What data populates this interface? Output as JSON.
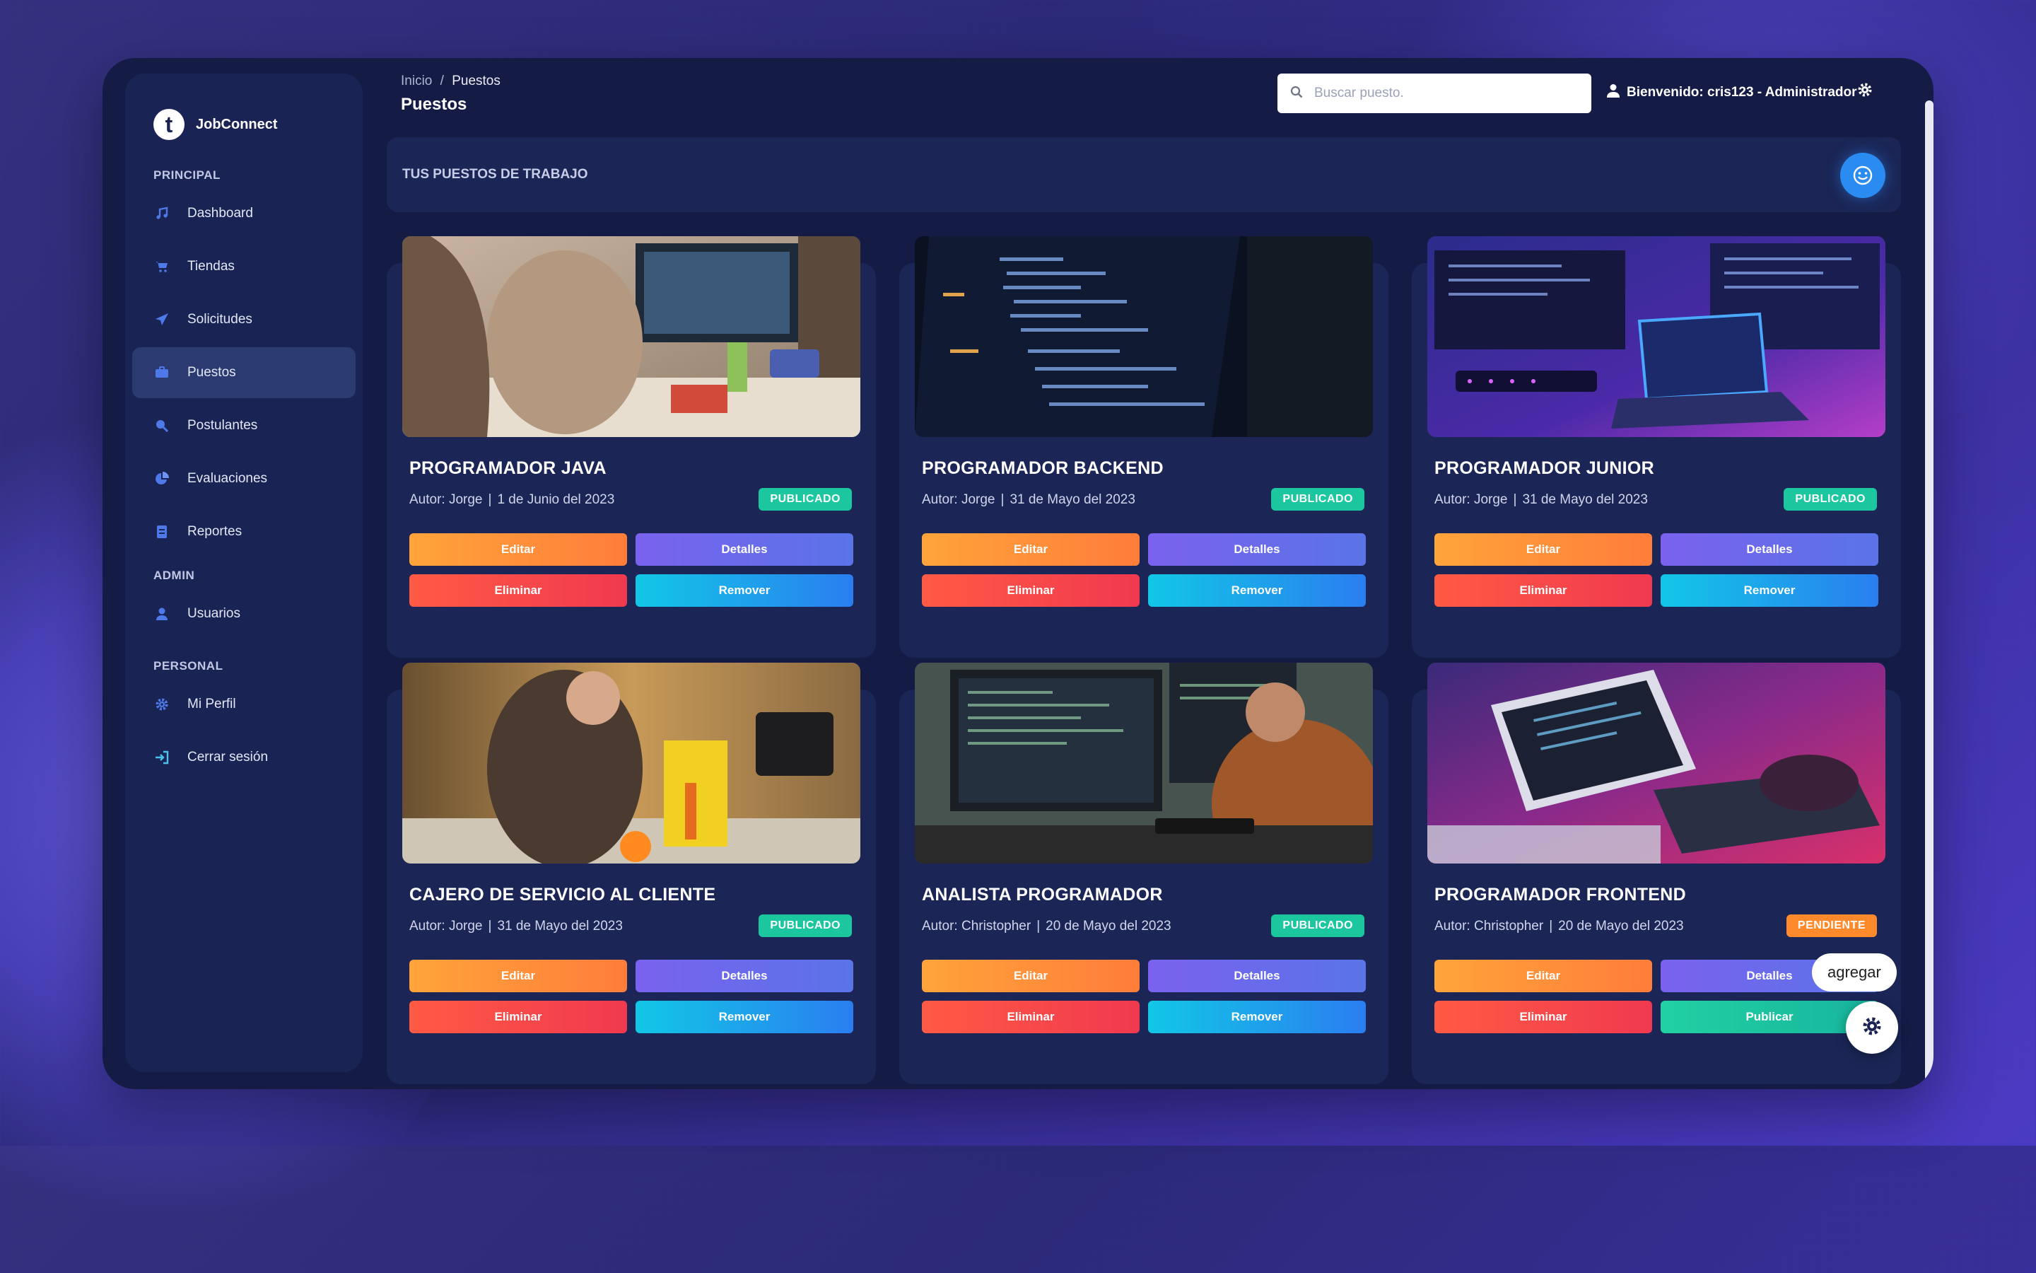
{
  "brand": {
    "name": "JobConnect",
    "logo_glyph": "t"
  },
  "sidebar": {
    "sections": [
      "PRINCIPAL",
      "ADMIN",
      "PERSONAL"
    ],
    "items": [
      {
        "label": "Dashboard",
        "icon": "music-note-icon"
      },
      {
        "label": "Tiendas",
        "icon": "cart-icon"
      },
      {
        "label": "Solicitudes",
        "icon": "paper-plane-icon"
      },
      {
        "label": "Puestos",
        "icon": "briefcase-icon",
        "active": true
      },
      {
        "label": "Postulantes",
        "icon": "search-person-icon"
      },
      {
        "label": "Evaluaciones",
        "icon": "pie-chart-icon"
      },
      {
        "label": "Reportes",
        "icon": "report-icon"
      },
      {
        "label": "Usuarios",
        "icon": "user-icon"
      },
      {
        "label": "Mi Perfil",
        "icon": "gear-icon"
      },
      {
        "label": "Cerrar sesión",
        "icon": "sign-out-icon"
      }
    ]
  },
  "header": {
    "breadcrumb": {
      "home": "Inicio",
      "separator": "/",
      "current": "Puestos"
    },
    "title": "Puestos",
    "search_placeholder": "Buscar puesto.",
    "welcome": "Bienvenido: cris123 - Administrador"
  },
  "panel": {
    "title": "TUS PUESTOS DE TRABAJO"
  },
  "jobs": [
    {
      "title": "PROGRAMADOR JAVA",
      "author": "Autor: Jorge",
      "date": "1 de Junio del 2023",
      "status": "PUBLICADO",
      "buttons": [
        "Editar",
        "Detalles",
        "Eliminar",
        "Remover"
      ]
    },
    {
      "title": "PROGRAMADOR BACKEND",
      "author": "Autor: Jorge",
      "date": "31 de Mayo del 2023",
      "status": "PUBLICADO",
      "buttons": [
        "Editar",
        "Detalles",
        "Eliminar",
        "Remover"
      ]
    },
    {
      "title": "PROGRAMADOR JUNIOR",
      "author": "Autor: Jorge",
      "date": "31 de Mayo del 2023",
      "status": "PUBLICADO",
      "buttons": [
        "Editar",
        "Detalles",
        "Eliminar",
        "Remover"
      ]
    },
    {
      "title": "CAJERO DE SERVICIO AL CLIENTE",
      "author": "Autor: Jorge",
      "date": "31 de Mayo del 2023",
      "status": "PUBLICADO",
      "buttons": [
        "Editar",
        "Detalles",
        "Eliminar",
        "Remover"
      ]
    },
    {
      "title": "ANALISTA PROGRAMADOR",
      "author": "Autor: Christopher",
      "date": "20 de Mayo del 2023",
      "status": "PUBLICADO",
      "buttons": [
        "Editar",
        "Detalles",
        "Eliminar",
        "Remover"
      ]
    },
    {
      "title": "PROGRAMADOR FRONTEND",
      "author": "Autor: Christopher",
      "date": "20 de Mayo del 2023",
      "status": "PENDIENTE",
      "buttons": [
        "Editar",
        "Detalles",
        "Eliminar",
        "Publicar"
      ]
    }
  ],
  "floating": {
    "tooltip": "agregar"
  },
  "colors": {
    "published": "#1cc7a0",
    "pending": "#ff8a2b",
    "accent": "#2a8cf0"
  }
}
